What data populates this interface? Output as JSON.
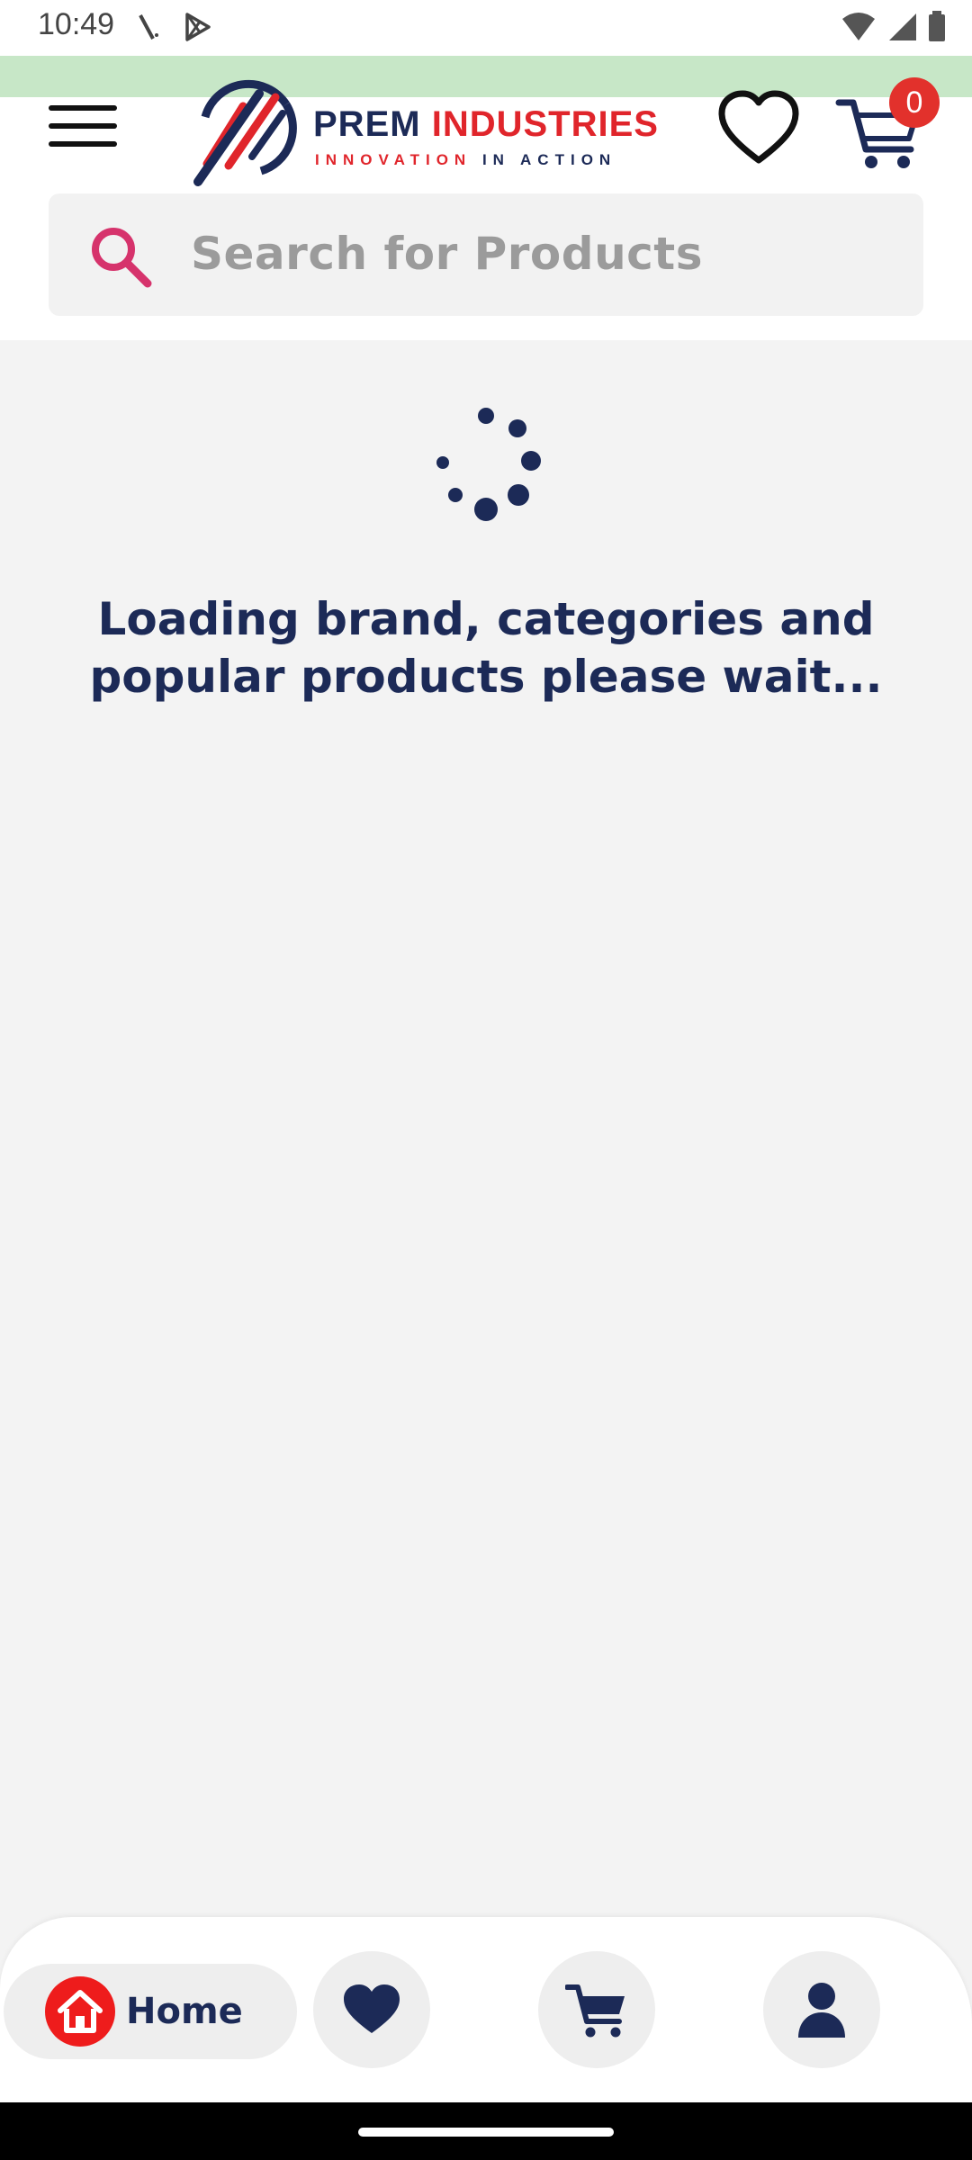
{
  "status_bar": {
    "time": "10:49",
    "left_icons": [
      "mute-icon",
      "play-store-icon"
    ],
    "right_icons": [
      "wifi-icon",
      "signal-icon",
      "battery-icon"
    ]
  },
  "header": {
    "menu_icon": "hamburger-menu-icon",
    "logo": {
      "brand_part1": "PREM",
      "brand_part2": "INDUSTRIES",
      "tagline_part1": "INNOVATION",
      "tagline_part2": "IN",
      "tagline_part3": "ACTION"
    },
    "wishlist_icon": "heart-outline-icon",
    "cart_icon": "cart-icon",
    "cart_count": "0"
  },
  "search": {
    "placeholder": "Search for Products",
    "icon": "search-icon"
  },
  "loading": {
    "message": "Loading brand, categories and popular products please wait..."
  },
  "bottom_nav": {
    "items": [
      {
        "label": "Home",
        "icon": "home-icon",
        "active": true
      },
      {
        "label": "",
        "icon": "heart-filled-icon",
        "active": false
      },
      {
        "label": "",
        "icon": "cart-icon",
        "active": false
      },
      {
        "label": "",
        "icon": "person-icon",
        "active": false
      }
    ]
  },
  "colors": {
    "navy": "#1c2a57",
    "red": "#e0252b",
    "pink_search": "#d6336c",
    "strip_green": "#c7e7c7",
    "background": "#f3f3f3"
  }
}
